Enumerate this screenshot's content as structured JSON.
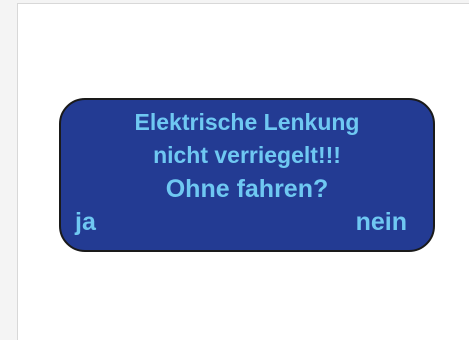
{
  "dialog": {
    "message_line1": "Elektrische Lenkung",
    "message_line2": "nicht verriegelt!!!",
    "question": "Ohne fahren?",
    "yes_label": "ja",
    "no_label": "nein"
  },
  "colors": {
    "dialog_background": "#233b93",
    "text": "#6fc8f2",
    "border": "#1a1a1a",
    "screen_background": "#ffffff"
  }
}
